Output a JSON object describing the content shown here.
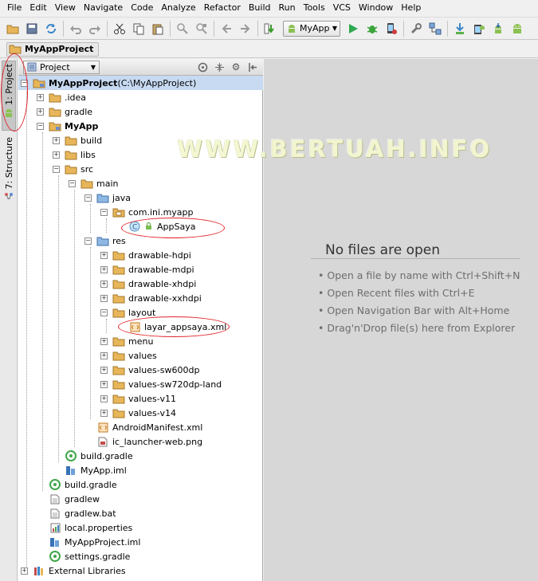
{
  "menu": [
    "File",
    "Edit",
    "View",
    "Navigate",
    "Code",
    "Analyze",
    "Refactor",
    "Build",
    "Run",
    "Tools",
    "VCS",
    "Window",
    "Help"
  ],
  "toolbar": {
    "run_config": "MyApp"
  },
  "navbar": {
    "crumb": "MyAppProject"
  },
  "left_strip": {
    "project_tab": "1: Project",
    "structure_tab": "7: Structure"
  },
  "project_panel": {
    "view_select": "Project"
  },
  "tree": [
    {
      "label": "MyAppProject",
      "suffix": " (C:\\MyAppProject)",
      "icon": "module-folder-icon"
    },
    {
      "label": ".idea",
      "icon": "folder-icon"
    },
    {
      "label": "gradle",
      "icon": "folder-icon"
    },
    {
      "label": "MyApp",
      "icon": "module-folder-icon"
    },
    {
      "label": "build",
      "icon": "folder-icon"
    },
    {
      "label": "libs",
      "icon": "folder-icon"
    },
    {
      "label": "src",
      "icon": "folder-icon"
    },
    {
      "label": "main",
      "icon": "folder-icon"
    },
    {
      "label": "java",
      "icon": "source-folder-icon"
    },
    {
      "label": "com.ini.myapp",
      "icon": "package-icon"
    },
    {
      "label": "AppSaya",
      "icon": "class-icon"
    },
    {
      "label": "res",
      "icon": "resource-folder-icon"
    },
    {
      "label": "drawable-hdpi",
      "icon": "folder-icon"
    },
    {
      "label": "drawable-mdpi",
      "icon": "folder-icon"
    },
    {
      "label": "drawable-xhdpi",
      "icon": "folder-icon"
    },
    {
      "label": "drawable-xxhdpi",
      "icon": "folder-icon"
    },
    {
      "label": "layout",
      "icon": "folder-icon"
    },
    {
      "label": "layar_appsaya.xml",
      "icon": "xml-file-icon"
    },
    {
      "label": "menu",
      "icon": "folder-icon"
    },
    {
      "label": "values",
      "icon": "folder-icon"
    },
    {
      "label": "values-sw600dp",
      "icon": "folder-icon"
    },
    {
      "label": "values-sw720dp-land",
      "icon": "folder-icon"
    },
    {
      "label": "values-v11",
      "icon": "folder-icon"
    },
    {
      "label": "values-v14",
      "icon": "folder-icon"
    },
    {
      "label": "AndroidManifest.xml",
      "icon": "xml-file-icon"
    },
    {
      "label": "ic_launcher-web.png",
      "icon": "image-file-icon"
    },
    {
      "label": "build.gradle",
      "icon": "gradle-file-icon"
    },
    {
      "label": "MyApp.iml",
      "icon": "iml-file-icon"
    },
    {
      "label": "build.gradle",
      "icon": "gradle-file-icon"
    },
    {
      "label": "gradlew",
      "icon": "text-file-icon"
    },
    {
      "label": "gradlew.bat",
      "icon": "text-file-icon"
    },
    {
      "label": "local.properties",
      "icon": "properties-file-icon"
    },
    {
      "label": "MyAppProject.iml",
      "icon": "iml-file-icon"
    },
    {
      "label": "settings.gradle",
      "icon": "gradle-file-icon"
    },
    {
      "label": "External Libraries",
      "icon": "library-icon"
    }
  ],
  "editor": {
    "watermark": "WWW.BERTUAH.INFO",
    "empty_title": "No files are open",
    "hints": [
      "Open a file by name with Ctrl+Shift+N",
      "Open Recent files with Ctrl+E",
      "Open Navigation Bar with Alt+Home",
      "Drag'n'Drop file(s) here from Explorer"
    ]
  },
  "colors": {
    "selection": "#c7daf1",
    "folder": "#e8b65a",
    "annotation": "#e0252c",
    "editor_bg": "#d7d7d7"
  }
}
